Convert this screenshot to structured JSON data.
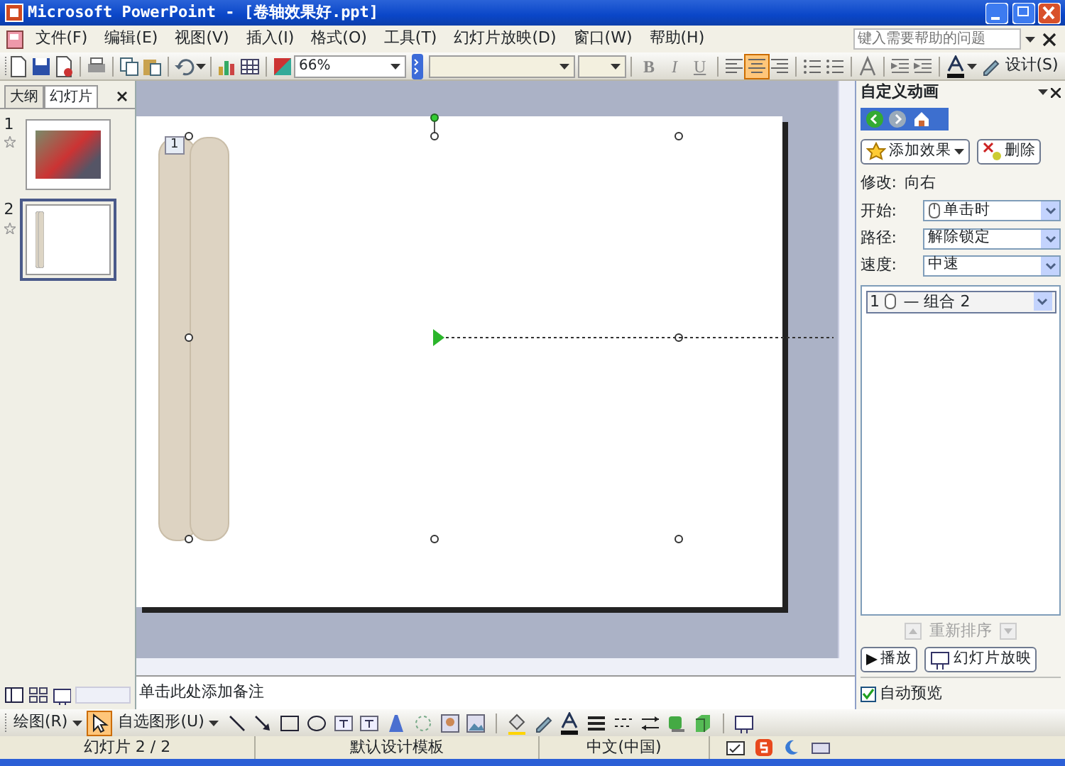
{
  "window": {
    "title": "Microsoft PowerPoint - [卷轴效果好.ppt]"
  },
  "menu": [
    "文件(F)",
    "编辑(E)",
    "视图(V)",
    "插入(I)",
    "格式(O)",
    "工具(T)",
    "幻灯片放映(D)",
    "窗口(W)",
    "帮助(H)"
  ],
  "help_search": {
    "placeholder": "键入需要帮助的问题"
  },
  "toolbar": {
    "zoom": "66%",
    "design": "设计(S)"
  },
  "format_buttons": [
    "B",
    "I",
    "U"
  ],
  "align_buttons": [
    {
      "kind": "left",
      "selected": false
    },
    {
      "kind": "center",
      "selected": true
    },
    {
      "kind": "right",
      "selected": false
    }
  ],
  "side_tabs": [
    {
      "label": "大纲",
      "selected": false
    },
    {
      "label": "幻灯片",
      "selected": true
    }
  ],
  "slides": [
    {
      "number": "1",
      "kind": "photo",
      "selected": false
    },
    {
      "number": "2",
      "kind": "scroll",
      "selected": true
    }
  ],
  "slide": {
    "animation_tag": "1"
  },
  "notes": {
    "placeholder": "单击此处添加备注"
  },
  "drawing_toolbar": {
    "draw_menu": "绘图(R)",
    "autoshapes_menu": "自选图形(U)",
    "pointer_selected": true
  },
  "task_pane": {
    "title": "自定义动画",
    "add_effect": "添加效果",
    "remove": "删除",
    "modify_label": "修改:",
    "modify_value": "向右",
    "fields": [
      {
        "label": "开始:",
        "value": "单击时",
        "kind": "mouse"
      },
      {
        "label": "路径:",
        "value": "解除锁定",
        "kind": "plain"
      },
      {
        "label": "速度:",
        "value": "中速",
        "kind": "plain"
      }
    ],
    "animations": [
      {
        "order": "1",
        "name": "— 组合 2",
        "selected": true
      }
    ],
    "reorder": {
      "label": "重新排序",
      "disabled": true
    },
    "play": "播放",
    "slideshow": "幻灯片放映",
    "autopreview": {
      "label": "自动预览",
      "checked": true
    }
  },
  "status_bar": [
    "幻灯片 2 / 2",
    "默认设计模板",
    "中文(中国)"
  ]
}
